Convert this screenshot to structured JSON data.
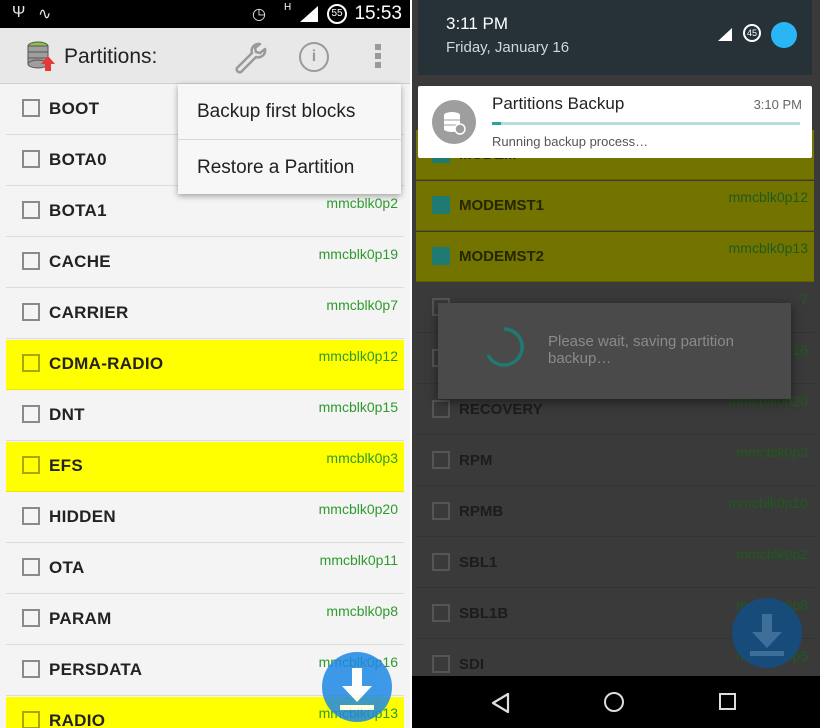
{
  "left_screen": {
    "status_bar": {
      "time": "15:53",
      "battery": "55",
      "network": "H"
    },
    "action_bar": {
      "title": "Partitions:"
    },
    "overflow_menu": {
      "items": [
        "Backup first blocks",
        "Restore a Partition"
      ]
    },
    "partitions": [
      {
        "name": "BOOT",
        "device": "",
        "highlighted": false
      },
      {
        "name": "BOTA0",
        "device": "",
        "highlighted": false
      },
      {
        "name": "BOTA1",
        "device": "mmcblk0p2",
        "highlighted": false
      },
      {
        "name": "CACHE",
        "device": "mmcblk0p19",
        "highlighted": false
      },
      {
        "name": "CARRIER",
        "device": "mmcblk0p7",
        "highlighted": false
      },
      {
        "name": "CDMA-RADIO",
        "device": "mmcblk0p12",
        "highlighted": true
      },
      {
        "name": "DNT",
        "device": "mmcblk0p15",
        "highlighted": false
      },
      {
        "name": "EFS",
        "device": "mmcblk0p3",
        "highlighted": true
      },
      {
        "name": "HIDDEN",
        "device": "mmcblk0p20",
        "highlighted": false
      },
      {
        "name": "OTA",
        "device": "mmcblk0p11",
        "highlighted": false
      },
      {
        "name": "PARAM",
        "device": "mmcblk0p8",
        "highlighted": false
      },
      {
        "name": "PERSDATA",
        "device": "mmcblk0p16",
        "highlighted": false
      },
      {
        "name": "RADIO",
        "device": "mmcblk0p13",
        "highlighted": true
      }
    ]
  },
  "right_screen": {
    "shade": {
      "time": "3:11 PM",
      "date": "Friday, January 16",
      "badge": "45"
    },
    "notification": {
      "title": "Partitions Backup",
      "time": "3:10 PM",
      "text": "Running backup process…",
      "progress_fraction": 0.03
    },
    "partitions": [
      {
        "name": "MODEM",
        "device": "",
        "checked": true,
        "highlighted": true
      },
      {
        "name": "MODEMST1",
        "device": "mmcblk0p12",
        "checked": true,
        "highlighted": true
      },
      {
        "name": "MODEMST2",
        "device": "mmcblk0p13",
        "checked": true,
        "highlighted": true
      },
      {
        "name": "",
        "device": "7",
        "checked": false,
        "highlighted": false
      },
      {
        "name": "",
        "device": "16",
        "checked": false,
        "highlighted": false
      },
      {
        "name": "RECOVERY",
        "device": "mmcblk0p20",
        "checked": false,
        "highlighted": false
      },
      {
        "name": "RPM",
        "device": "mmcblk0p3",
        "checked": false,
        "highlighted": false
      },
      {
        "name": "RPMB",
        "device": "mmcblk0p10",
        "checked": false,
        "highlighted": false
      },
      {
        "name": "SBL1",
        "device": "mmcblk0p2",
        "checked": false,
        "highlighted": false
      },
      {
        "name": "SBL1B",
        "device": "mmcblk0p8",
        "checked": false,
        "highlighted": false
      },
      {
        "name": "SDI",
        "device": "mmcblk0p5",
        "checked": false,
        "highlighted": false
      }
    ],
    "dialog": {
      "message": "Please wait, saving partition backup…"
    }
  },
  "colors": {
    "highlight": "#ffff00",
    "device_green": "#2e9a2e",
    "fab_blue": "#1e88e5",
    "accent_teal": "#26a69a"
  },
  "icons": {
    "app": "database-upload-icon",
    "wrench": "wrench-icon",
    "info": "info-icon",
    "more": "more-vert-icon",
    "download": "download-icon"
  }
}
